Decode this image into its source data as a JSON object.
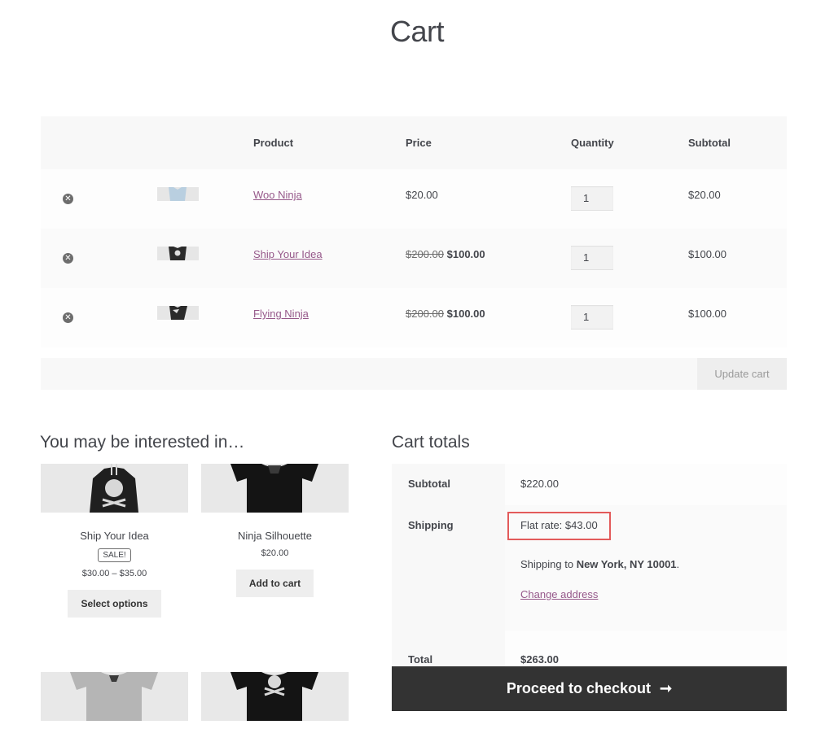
{
  "page": {
    "title": "Cart"
  },
  "cart": {
    "headers": {
      "product": "Product",
      "price": "Price",
      "quantity": "Quantity",
      "subtotal": "Subtotal"
    },
    "items": [
      {
        "name": "Woo Ninja",
        "price_old": "",
        "price": "$20.00",
        "quantity": "1",
        "subtotal": "$20.00"
      },
      {
        "name": "Ship Your Idea",
        "price_old": "$200.00",
        "price": "$100.00",
        "quantity": "1",
        "subtotal": "$100.00"
      },
      {
        "name": "Flying Ninja",
        "price_old": "$200.00",
        "price": "$100.00",
        "quantity": "1",
        "subtotal": "$100.00"
      }
    ],
    "remove_glyph": "✕",
    "update_label": "Update cart"
  },
  "cross_sells": {
    "title": "You may be interested in…",
    "products": [
      {
        "name": "Ship Your Idea",
        "badge": "SALE!",
        "price": "$30.00 – $35.00",
        "button": "Select options"
      },
      {
        "name": "Ninja Silhouette",
        "badge": "",
        "price": "$20.00",
        "button": "Add to cart"
      },
      {
        "name": "",
        "badge": "",
        "price": "",
        "button": ""
      },
      {
        "name": "",
        "badge": "",
        "price": "",
        "button": ""
      }
    ]
  },
  "totals": {
    "title": "Cart totals",
    "subtotal_label": "Subtotal",
    "subtotal_value": "$220.00",
    "shipping_label": "Shipping",
    "flat_rate": "Flat rate: $43.00",
    "shipping_to_prefix": "Shipping to",
    "shipping_to_location": "New York, NY 10001",
    "shipping_to_suffix": ".",
    "change_address": "Change address",
    "total_label": "Total",
    "total_value": "$263.00"
  },
  "checkout": {
    "label": "Proceed to checkout",
    "arrow": "➞"
  },
  "colors": {
    "link": "#96588a",
    "highlight_box": "#e35a5a",
    "checkout_bg": "#333333"
  }
}
